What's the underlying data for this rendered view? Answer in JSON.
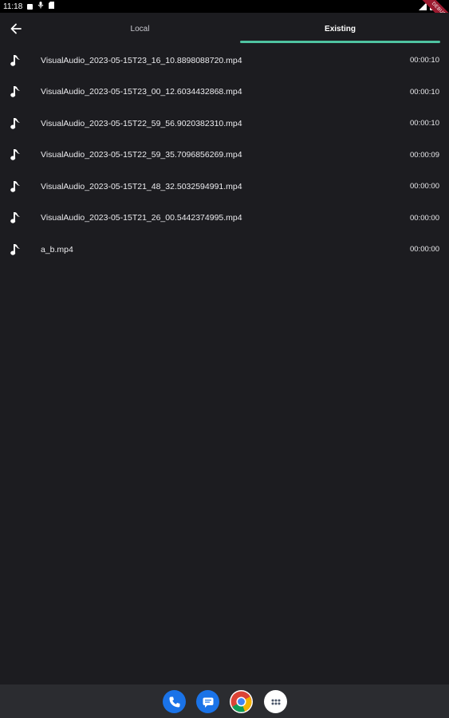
{
  "status_bar": {
    "time": "11:18",
    "debug_banner": "DEBUG"
  },
  "tabs": [
    {
      "label": "Local",
      "selected": false
    },
    {
      "label": "Existing",
      "selected": true
    }
  ],
  "colors": {
    "background": "#1c1c20",
    "tab_indicator": "#4fc3a1",
    "dock": "#2b2c30"
  },
  "files": [
    {
      "name": "VisualAudio_2023-05-15T23_16_10.8898088720.mp4",
      "duration": "00:00:10",
      "icon": "music-note-icon"
    },
    {
      "name": "VisualAudio_2023-05-15T23_00_12.6034432868.mp4",
      "duration": "00:00:10",
      "icon": "music-note-icon"
    },
    {
      "name": "VisualAudio_2023-05-15T22_59_56.9020382310.mp4",
      "duration": "00:00:10",
      "icon": "music-note-icon"
    },
    {
      "name": "VisualAudio_2023-05-15T22_59_35.7096856269.mp4",
      "duration": "00:00:09",
      "icon": "music-note-icon"
    },
    {
      "name": "VisualAudio_2023-05-15T21_48_32.5032594991.mp4",
      "duration": "00:00:00",
      "icon": "music-note-icon"
    },
    {
      "name": "VisualAudio_2023-05-15T21_26_00.5442374995.mp4",
      "duration": "00:00:00",
      "icon": "music-note-icon"
    },
    {
      "name": "a_b.mp4",
      "duration": "00:00:00",
      "icon": "music-note-icon"
    }
  ],
  "dock": [
    {
      "icon": "phone-icon"
    },
    {
      "icon": "messages-icon"
    },
    {
      "icon": "chrome-icon"
    },
    {
      "icon": "app-drawer-icon"
    }
  ]
}
